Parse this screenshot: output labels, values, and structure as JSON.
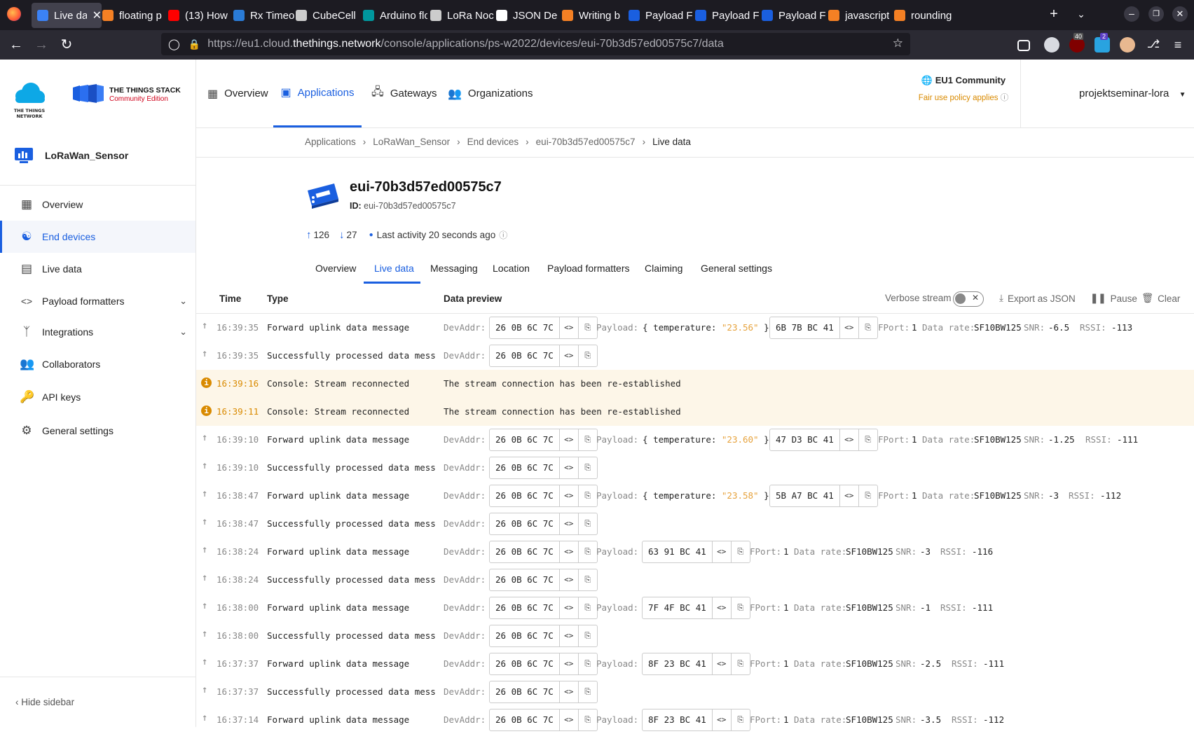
{
  "browser": {
    "tabs": [
      {
        "label": "Live da",
        "active": true,
        "color": "#3b82f6"
      },
      {
        "label": "floating p",
        "color": "#f48024"
      },
      {
        "label": "(13) How",
        "color": "#ff0000"
      },
      {
        "label": "Rx Timeo",
        "color": "#2a7bd6"
      },
      {
        "label": "CubeCell",
        "color": "#cccccc"
      },
      {
        "label": "Arduino floa",
        "color": "#00979d"
      },
      {
        "label": "LoRa Noc",
        "color": "#cccccc"
      },
      {
        "label": "JSON De",
        "color": "#ffffff"
      },
      {
        "label": "Writing b",
        "color": "#f48024"
      },
      {
        "label": "Payload F",
        "color": "#1a5fe0"
      },
      {
        "label": "Payload F",
        "color": "#1a5fe0"
      },
      {
        "label": "Payload F",
        "color": "#1a5fe0"
      },
      {
        "label": "javascript",
        "color": "#f48024"
      },
      {
        "label": "rounding",
        "color": "#f48024"
      }
    ],
    "url_prefix": "https://eu1.cloud.",
    "url_domain": "thethings.network",
    "url_path": "/console/applications/ps-w2022/devices/eui-70b3d57ed00575c7/data",
    "ext_badge_1": "40",
    "ext_badge_2": "2"
  },
  "header": {
    "brand_line1": "THE THINGS STACK",
    "brand_line2": "Community Edition",
    "ttn_line1": "THE THINGS",
    "ttn_line2": "NETWORK",
    "nav": [
      "Overview",
      "Applications",
      "Gateways",
      "Organizations"
    ],
    "cluster": "EU1 Community",
    "fair_use": "Fair use policy applies",
    "user": "projektseminar-lora"
  },
  "sidebar": {
    "app_name": "LoRaWan_Sensor",
    "items": [
      {
        "label": "Overview",
        "icon": "grid-icon"
      },
      {
        "label": "End devices",
        "icon": "devices-icon",
        "active": true
      },
      {
        "label": "Live data",
        "icon": "list-icon"
      },
      {
        "label": "Payload formatters",
        "icon": "code-icon",
        "expandable": true
      },
      {
        "label": "Integrations",
        "icon": "merge-icon",
        "expandable": true
      },
      {
        "label": "Collaborators",
        "icon": "people-icon"
      },
      {
        "label": "API keys",
        "icon": "key-icon"
      },
      {
        "label": "General settings",
        "icon": "gear-icon"
      }
    ],
    "hide_label": "Hide sidebar"
  },
  "breadcrumb": [
    "Applications",
    "LoRaWan_Sensor",
    "End devices",
    "eui-70b3d57ed00575c7",
    "Live data"
  ],
  "device": {
    "title": "eui-70b3d57ed00575c7",
    "id_label": "ID:",
    "id_value": "eui-70b3d57ed00575c7",
    "uplink": "126",
    "downlink": "27",
    "last_activity": "Last activity 20 seconds ago"
  },
  "tabs": [
    "Overview",
    "Live data",
    "Messaging",
    "Location",
    "Payload formatters",
    "Claiming",
    "General settings"
  ],
  "table": {
    "headers": [
      "Time",
      "Type",
      "Data preview"
    ],
    "verbose": "Verbose stream",
    "export": "Export as JSON",
    "pause": "Pause",
    "clear": "Clear",
    "devaddr_label": "DevAddr:",
    "payload_label": "Payload:",
    "fport_label": "FPort:",
    "rate_label": "Data rate:",
    "snr_label": "SNR:",
    "rssi_label": "RSSI:",
    "devaddr": "26 0B 6C 7C",
    "reconnect_msg": "The stream connection has been re-established",
    "rows": [
      {
        "time": "16:39:35",
        "type": "Forward uplink data message",
        "kind": "uplink-decoded",
        "temp": "\"23.56\"",
        "payload": "6B 7B BC 41",
        "fport": "1",
        "rate": "SF10BW125",
        "snr": "-6.5",
        "rssi": "-113"
      },
      {
        "time": "16:39:35",
        "type": "Successfully processed data mess…",
        "kind": "processed"
      },
      {
        "time": "16:39:16",
        "type": "Console: Stream reconnected",
        "kind": "warn"
      },
      {
        "time": "16:39:11",
        "type": "Console: Stream reconnected",
        "kind": "warn"
      },
      {
        "time": "16:39:10",
        "type": "Forward uplink data message",
        "kind": "uplink-decoded",
        "temp": "\"23.60\"",
        "payload": "47 D3 BC 41",
        "fport": "1",
        "rate": "SF10BW125",
        "snr": "-1.25",
        "rssi": "-111"
      },
      {
        "time": "16:39:10",
        "type": "Successfully processed data mess…",
        "kind": "processed"
      },
      {
        "time": "16:38:47",
        "type": "Forward uplink data message",
        "kind": "uplink-decoded",
        "temp": "\"23.58\"",
        "payload": "5B A7 BC 41",
        "fport": "1",
        "rate": "SF10BW125",
        "snr": "-3",
        "rssi": "-112"
      },
      {
        "time": "16:38:47",
        "type": "Successfully processed data mess…",
        "kind": "processed"
      },
      {
        "time": "16:38:24",
        "type": "Forward uplink data message",
        "kind": "uplink-raw",
        "payload": "63 91 BC 41",
        "fport": "1",
        "rate": "SF10BW125",
        "snr": "-3",
        "rssi": "-116"
      },
      {
        "time": "16:38:24",
        "type": "Successfully processed data mess…",
        "kind": "processed"
      },
      {
        "time": "16:38:00",
        "type": "Forward uplink data message",
        "kind": "uplink-raw",
        "payload": "7F 4F BC 41",
        "fport": "1",
        "rate": "SF10BW125",
        "snr": "-1",
        "rssi": "-111"
      },
      {
        "time": "16:38:00",
        "type": "Successfully processed data mess…",
        "kind": "processed"
      },
      {
        "time": "16:37:37",
        "type": "Forward uplink data message",
        "kind": "uplink-raw",
        "payload": "8F 23 BC 41",
        "fport": "1",
        "rate": "SF10BW125",
        "snr": "-2.5",
        "rssi": "-111"
      },
      {
        "time": "16:37:37",
        "type": "Successfully processed data mess…",
        "kind": "processed"
      },
      {
        "time": "16:37:14",
        "type": "Forward uplink data message",
        "kind": "uplink-raw",
        "payload": "8F 23 BC 41",
        "fport": "1",
        "rate": "SF10BW125",
        "snr": "-3.5",
        "rssi": "-112"
      }
    ]
  }
}
